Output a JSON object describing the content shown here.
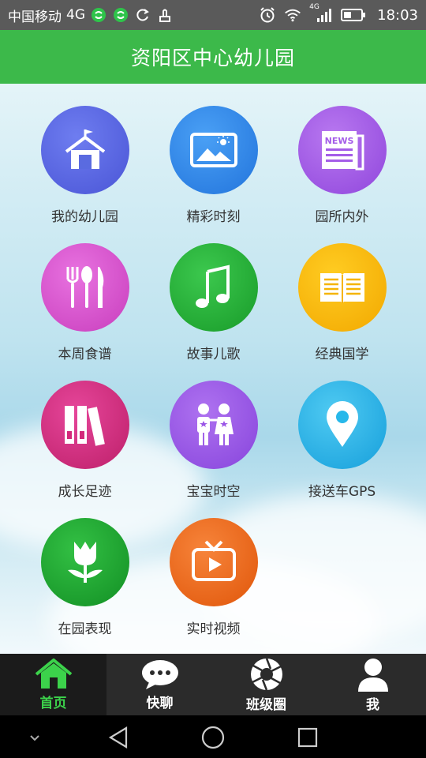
{
  "status_bar": {
    "carrier": "中国移动",
    "network": "4G",
    "signal_network": "4G",
    "time": "18:03"
  },
  "header": {
    "title": "资阳区中心幼儿园"
  },
  "tiles": [
    {
      "label": "我的幼儿园",
      "icon": "school-icon",
      "color": "#5a6be0"
    },
    {
      "label": "精彩时刻",
      "icon": "photo-icon",
      "color": "#2f86e8"
    },
    {
      "label": "园所内外",
      "icon": "news-icon",
      "color": "#a45de8"
    },
    {
      "label": "本周食谱",
      "icon": "cutlery-icon",
      "color": "#d955cf"
    },
    {
      "label": "故事儿歌",
      "icon": "music-note-icon",
      "color": "#22ad35"
    },
    {
      "label": "经典国学",
      "icon": "book-icon",
      "color": "#f5b400"
    },
    {
      "label": "成长足迹",
      "icon": "binders-icon",
      "color": "#d3297a"
    },
    {
      "label": "宝宝时空",
      "icon": "children-icon",
      "color": "#9a55e6"
    },
    {
      "label": "接送车GPS",
      "icon": "location-pin-icon",
      "color": "#27b8ea"
    },
    {
      "label": "在园表现",
      "icon": "tulip-icon",
      "color": "#1fa431"
    },
    {
      "label": "实时视频",
      "icon": "tv-icon",
      "color": "#f06a15"
    }
  ],
  "bottom_nav": [
    {
      "label": "首页",
      "icon": "home-icon",
      "active": true
    },
    {
      "label": "快聊",
      "icon": "chat-bubble-icon",
      "active": false
    },
    {
      "label": "班级圈",
      "icon": "aperture-icon",
      "active": false
    },
    {
      "label": "我",
      "icon": "person-icon",
      "active": false
    }
  ],
  "colors": {
    "header": "#3cb94a",
    "active_nav": "#3cd24b",
    "nav_bg": "#2b2b2b"
  }
}
